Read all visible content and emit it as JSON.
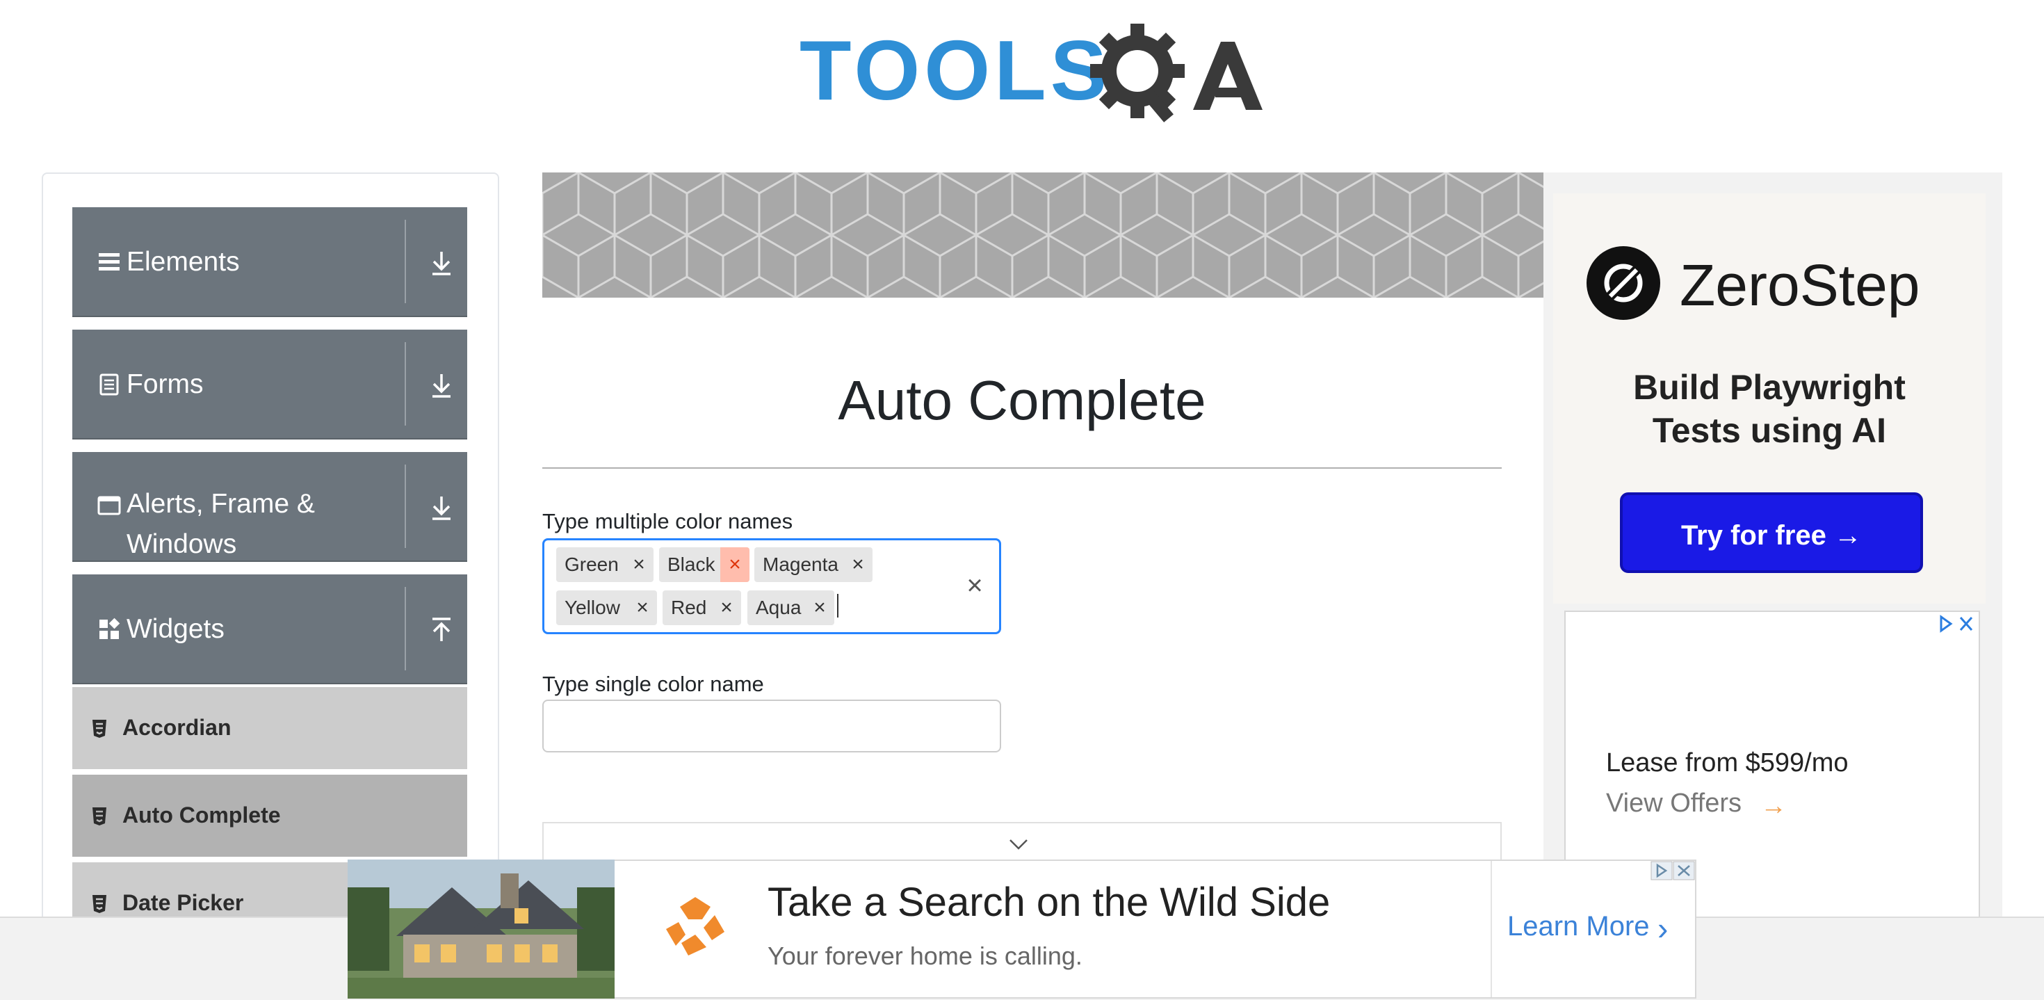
{
  "header": {
    "logo_text": "TOOLSQA"
  },
  "sidebar": {
    "groups": [
      {
        "label": "Elements",
        "icon": "hamburger-icon",
        "arrow": "download-icon"
      },
      {
        "label": "Forms",
        "icon": "document-icon",
        "arrow": "download-icon"
      },
      {
        "label_line1": "Alerts, Frame &",
        "label_line2": "Windows",
        "icon": "window-icon",
        "arrow": "download-icon"
      },
      {
        "label": "Widgets",
        "icon": "widgets-icon",
        "arrow": "upload-icon"
      }
    ],
    "items": [
      {
        "label": "Accordian",
        "active": false
      },
      {
        "label": "Auto Complete",
        "active": true
      },
      {
        "label": "Date Picker",
        "active": false
      }
    ]
  },
  "main": {
    "title": "Auto Complete",
    "multi": {
      "label": "Type multiple color names",
      "chips": [
        "Green",
        "Black",
        "Magenta",
        "Yellow",
        "Red",
        "Aqua"
      ],
      "hovered_chip": "Black",
      "clear_symbol": "×",
      "remove_symbol": "×"
    },
    "single": {
      "label": "Type single color name",
      "value": ""
    }
  },
  "right_ad": {
    "brand": "ZeroStep",
    "tagline_line1": "Build Playwright",
    "tagline_line2": "Tests using AI",
    "button": "Try for free →",
    "lease_line1": "Lease from $599/mo",
    "lease_line2": "View Offers",
    "lease_arrow": "→"
  },
  "bottom_ad": {
    "headline": "Take a Search on the Wild Side",
    "subtext": "Your forever home is calling.",
    "cta": "Learn More",
    "cta_chevron": "›"
  },
  "colors": {
    "sidebar_group": "#6c757d",
    "accent_blue": "#2684ff",
    "logo_blue": "#2f8fd6",
    "cta_blue": "#1a1ae6"
  }
}
